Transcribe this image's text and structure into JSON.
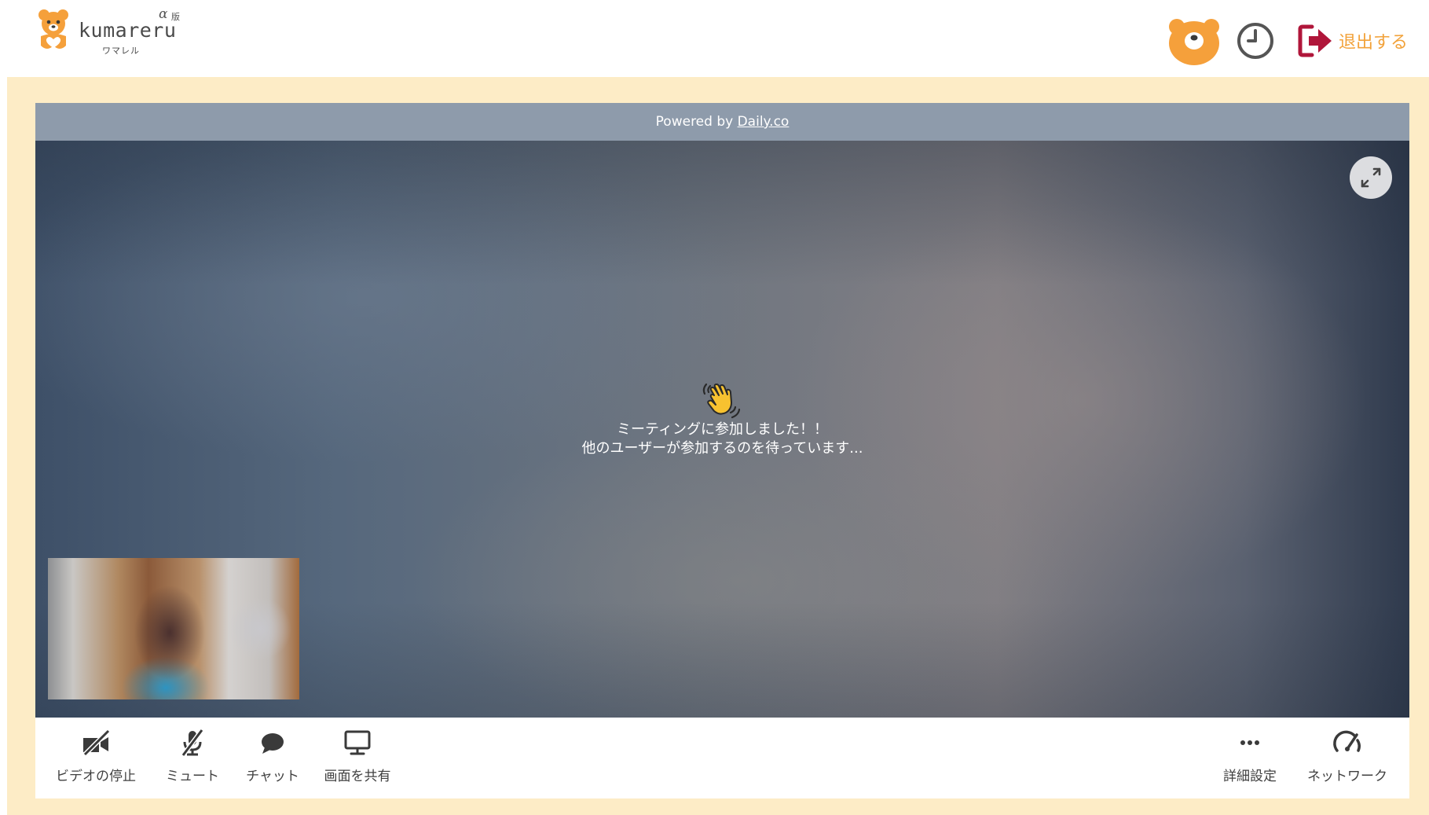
{
  "header": {
    "logo_word": "kumareru",
    "logo_kana": "ワマレル",
    "logo_alpha": "α",
    "logo_ban": "版",
    "exit_label": "退出する"
  },
  "call": {
    "powered_prefix": "Powered by ",
    "powered_link": "Daily.co",
    "message_line1": "ミーティングに参加しました！！",
    "message_line2": "他のユーザーが参加するのを待っています..."
  },
  "toolbar": {
    "video_stop": "ビデオの停止",
    "mute": "ミュート",
    "chat": "チャット",
    "screen_share": "画面を共有",
    "settings": "詳細設定",
    "network": "ネットワーク"
  },
  "colors": {
    "accent_orange": "#f2a23a",
    "bear_orange": "#f5a03b",
    "exit_red": "#b0163a",
    "frame_cream": "#fdecc6",
    "powered_bar": "#8e9bab"
  },
  "icons": {
    "logo": "bear-logo-icon",
    "bear": "bear-face-icon",
    "clock": "clock-icon",
    "exit": "exit-door-icon",
    "expand": "expand-arrows-icon",
    "wave": "waving-hand-icon",
    "video_off": "video-off-icon",
    "mic_off": "mic-off-icon",
    "chat": "chat-bubble-icon",
    "screen": "monitor-icon",
    "more": "more-dots-icon",
    "network": "gauge-icon"
  }
}
